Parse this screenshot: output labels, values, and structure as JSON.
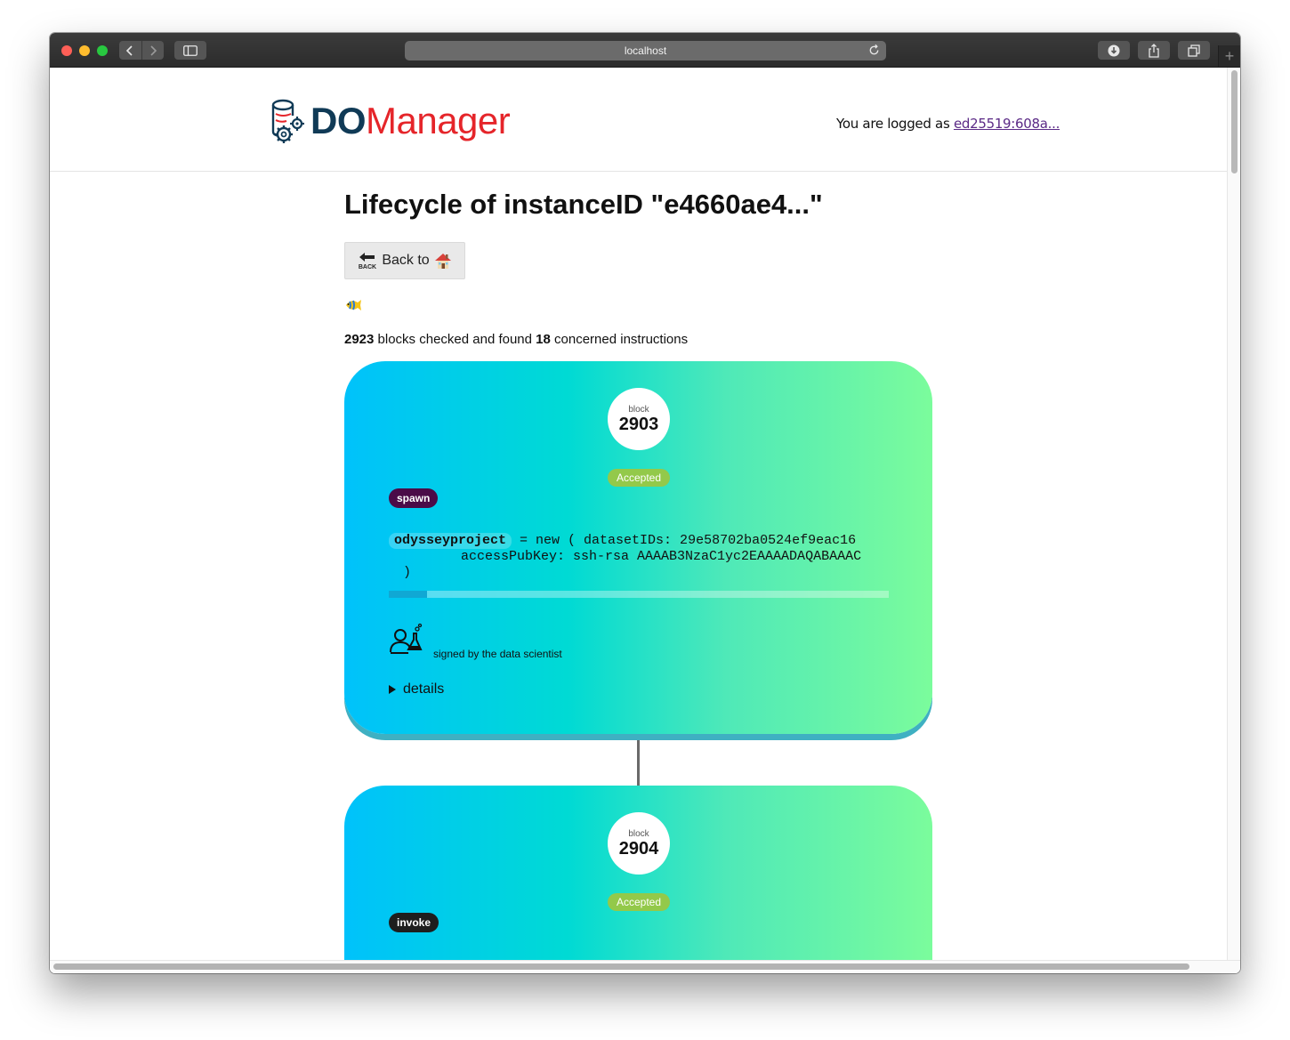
{
  "browser": {
    "url": "localhost"
  },
  "header": {
    "logo_part1": "DO",
    "logo_part2": "Manager",
    "login_prefix": "You are logged as ",
    "login_user": "ed25519:608a..."
  },
  "main": {
    "title": "Lifecycle of instanceID \"e4660ae4...\"",
    "back_label": "Back to",
    "stats": {
      "blocks": "2923",
      "mid_text": " blocks checked and found ",
      "instructions": "18",
      "end_text": " concerned instructions"
    }
  },
  "blocks": [
    {
      "label": "block",
      "number": "2903",
      "status": "Accepted",
      "type": "spawn",
      "code": {
        "var": "odysseyproject",
        "line1": " = new ( datasetIDs: 29e58702ba0524ef9eac16",
        "line2": "accessPubKey: ssh-rsa AAAAB3NzaC1yc2EAAAADAQABAAAC",
        "line3": ")"
      },
      "signed_by": "signed by the data scientist",
      "details_label": "details"
    },
    {
      "label": "block",
      "number": "2904",
      "status": "Accepted",
      "type": "invoke"
    }
  ],
  "colors": {
    "accepted": "#93c94a",
    "spawn": "#4b0b48",
    "invoke": "#1e1e1e",
    "logo_dark": "#103a56",
    "logo_red": "#e5252a"
  }
}
